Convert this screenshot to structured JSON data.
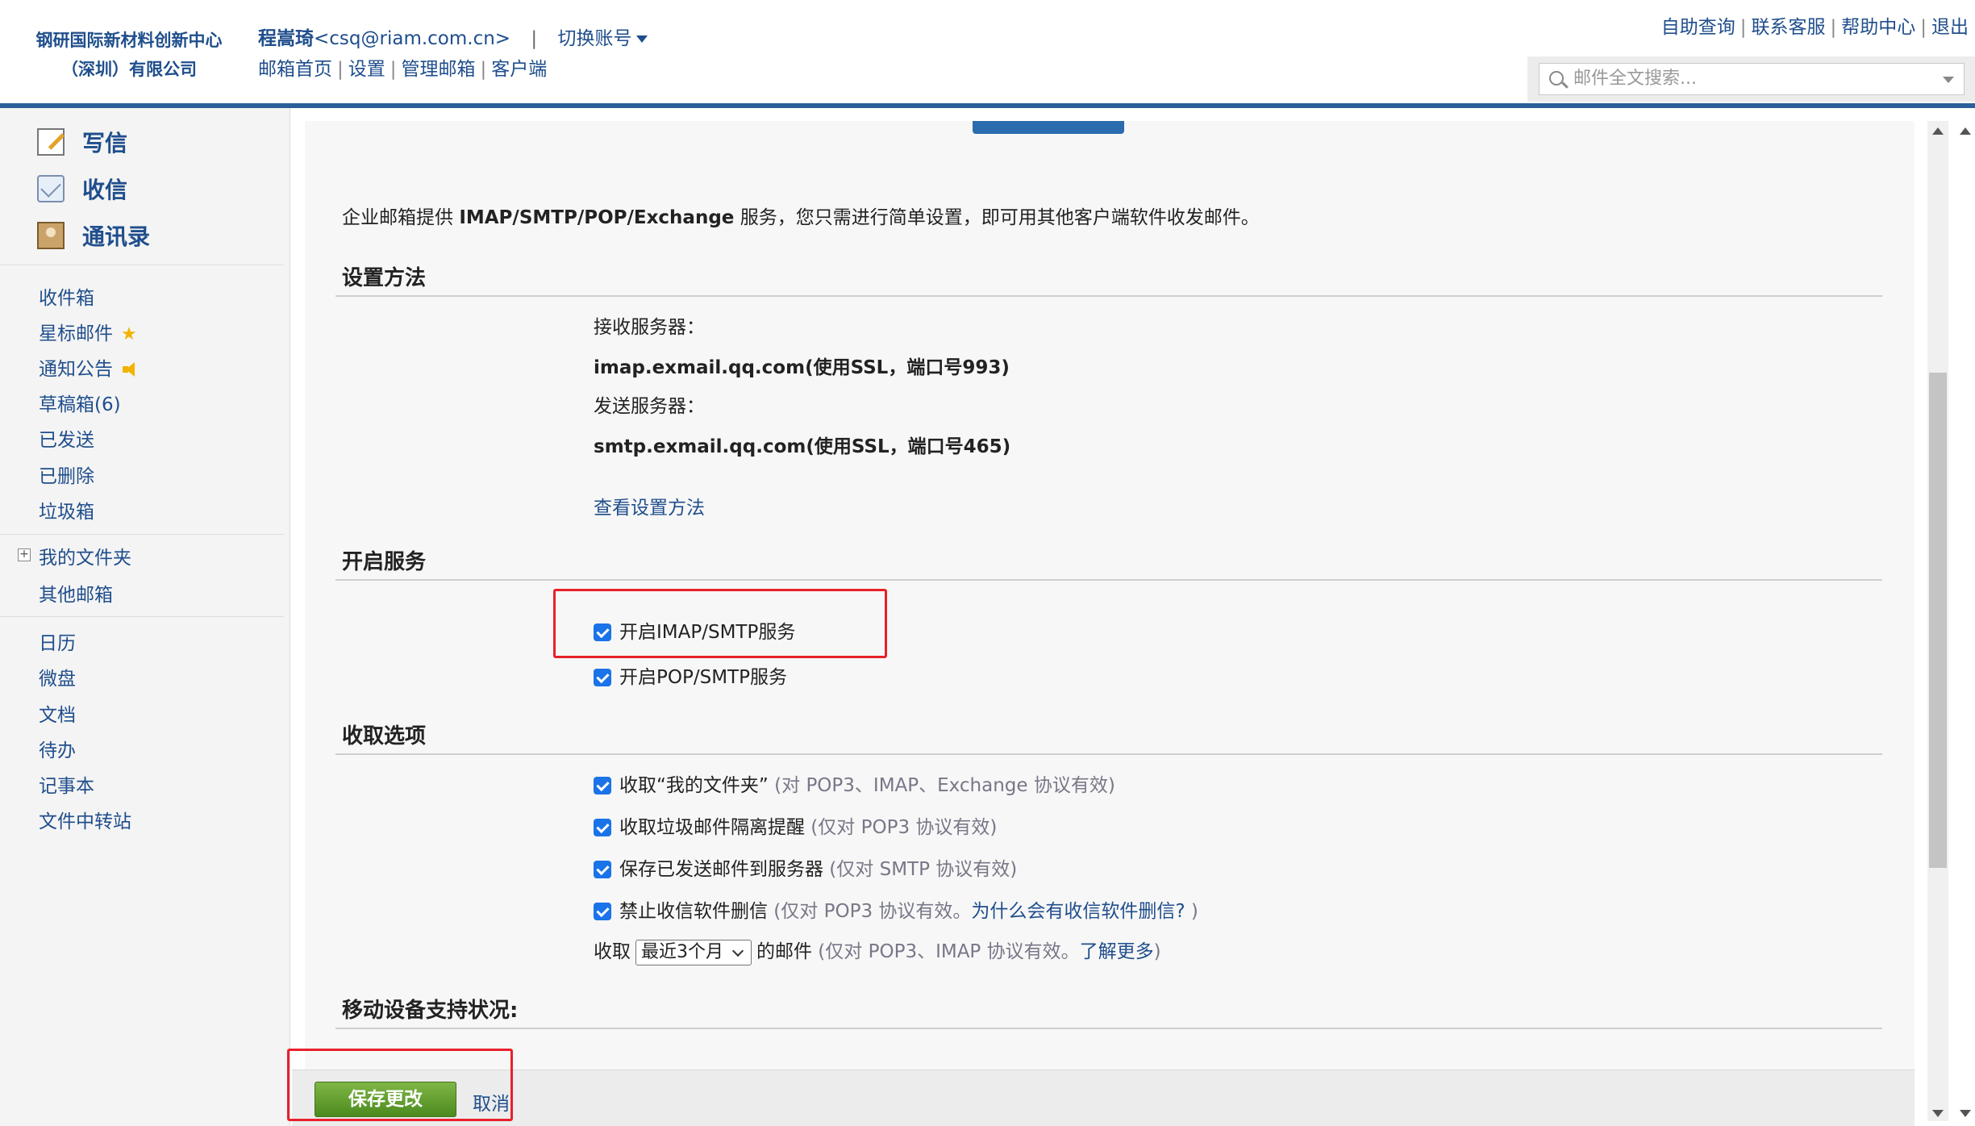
{
  "header": {
    "org_line1": "钢研国际新材料创新中心",
    "org_line2": "（深圳）有限公司",
    "user_name": "程嵩琦",
    "user_email": "<csq@riam.com.cn>",
    "switch_account": "切换账号",
    "nav": [
      "邮箱首页",
      "设置",
      "管理邮箱",
      "客户端"
    ],
    "top_links": [
      "自助查询",
      "联系客服",
      "帮助中心",
      "退出"
    ],
    "search_placeholder": "邮件全文搜索..."
  },
  "sidebar": {
    "write": "写信",
    "receive": "收信",
    "contacts": "通讯录",
    "folders": [
      "收件箱",
      "星标邮件",
      "通知公告",
      "草稿箱(6)",
      "已发送",
      "已删除",
      "垃圾箱"
    ],
    "my_folders": "我的文件夹",
    "other_mailbox": "其他邮箱",
    "apps": [
      "日历",
      "微盘",
      "文档",
      "待办",
      "记事本",
      "文件中转站"
    ]
  },
  "main": {
    "intro_prefix": "企业邮箱提供 ",
    "intro_protocols": "IMAP/SMTP/POP/Exchange",
    "intro_suffix": " 服务，您只需进行简单设置，即可用其他客户端软件收发邮件。",
    "setup": {
      "title": "设置方法",
      "incoming_label": "接收服务器：",
      "incoming_value": "imap.exmail.qq.com(使用SSL，端口号993)",
      "outgoing_label": "发送服务器：",
      "outgoing_value": "smtp.exmail.qq.com(使用SSL，端口号465)",
      "view_link": "查看设置方法"
    },
    "services": {
      "title": "开启服务",
      "imap_smtp": "开启IMAP/SMTP服务",
      "imap_smtp_checked": true,
      "pop_smtp": "开启POP/SMTP服务",
      "pop_smtp_checked": true
    },
    "receive_options": {
      "title": "收取选项",
      "opt1_label": "收取“我的文件夹”",
      "opt1_note": " (对 POP3、IMAP、Exchange 协议有效)",
      "opt2_label": "收取垃圾邮件隔离提醒",
      "opt2_note": " (仅对 POP3 协议有效)",
      "opt3_label": "保存已发送邮件到服务器",
      "opt3_note": " (仅对 SMTP 协议有效)",
      "opt4_label": "禁止收信软件删信",
      "opt4_note": " (仅对 POP3 协议有效。",
      "opt4_link": "为什么会有收信软件删信?",
      "opt4_close": " )",
      "receive_prefix": "收取",
      "receive_period": "最近3个月",
      "receive_suffix": "的邮件",
      "receive_note": " (仅对 POP3、IMAP 协议有效。",
      "learn_more": "了解更多",
      "receive_note_close": ")"
    },
    "mobile": {
      "title": "移动设备支持状况:"
    }
  },
  "footer": {
    "save": "保存更改",
    "cancel": "取消"
  },
  "colors": {
    "link": "#1f4e8c",
    "header_bar": "#2b5f9a",
    "save_button": "#5c9a2a",
    "highlight_box": "#e8202a",
    "checkbox": "#1a73e8"
  }
}
